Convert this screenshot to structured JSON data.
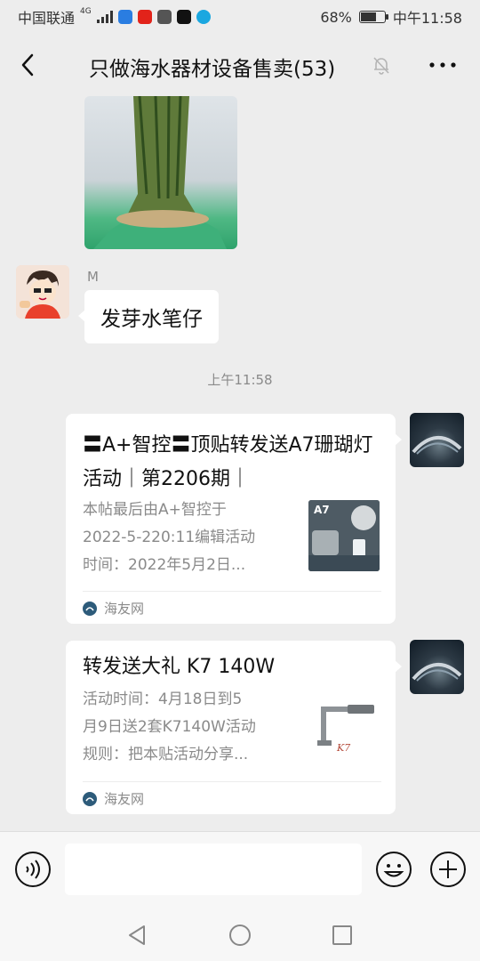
{
  "status_bar": {
    "carrier": "中国联通",
    "network": "4G",
    "battery_text": "68%",
    "battery_level": 0.68,
    "time": "中午11:58"
  },
  "nav": {
    "back_icon": "chevron-left-icon",
    "title": "只做海水器材设备售卖(53)",
    "mute_icon": "bell-off-icon",
    "more_icon": "more-dots-icon"
  },
  "messages": {
    "sender_name": "M",
    "text": "发芽水笔仔",
    "timestamp": "上午11:58",
    "cards": [
      {
        "title": "〓A+智控〓顶贴转发送A7珊瑚灯活动｜第2206期｜",
        "desc_lines": [
          "本帖最后由A+智控于",
          "2022-5-220:11编辑活动",
          "时间：2022年5月2日..."
        ],
        "thumb_label": "A7",
        "source": "海友网"
      },
      {
        "title": "转发送大礼 K7 140W",
        "desc_lines": [
          "活动时间：4月18日到5",
          "月9日送2套K7140W活动",
          "规则：把本贴活动分享..."
        ],
        "thumb_label": "",
        "source": "海友网"
      }
    ]
  },
  "input_bar": {
    "voice_icon": "voice-icon",
    "text_value": "",
    "emoji_icon": "emoji-icon",
    "plus_icon": "plus-icon"
  },
  "system_nav": {
    "back": "nav-back-icon",
    "home": "nav-home-icon",
    "recents": "nav-recents-icon"
  },
  "colors": {
    "background": "#ededed",
    "bubble": "#ffffff",
    "meta_text": "#8a8a8a",
    "source_icon": "#2d5b7a"
  }
}
